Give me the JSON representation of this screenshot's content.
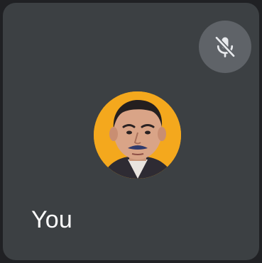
{
  "participant": {
    "name": "You",
    "mic_status_icon": "mic-off-icon",
    "avatar_icon": "avatar",
    "colors": {
      "tile_background": "#3c4043",
      "avatar_ring": "#f4a81d",
      "badge_background": "#5f6368"
    }
  }
}
